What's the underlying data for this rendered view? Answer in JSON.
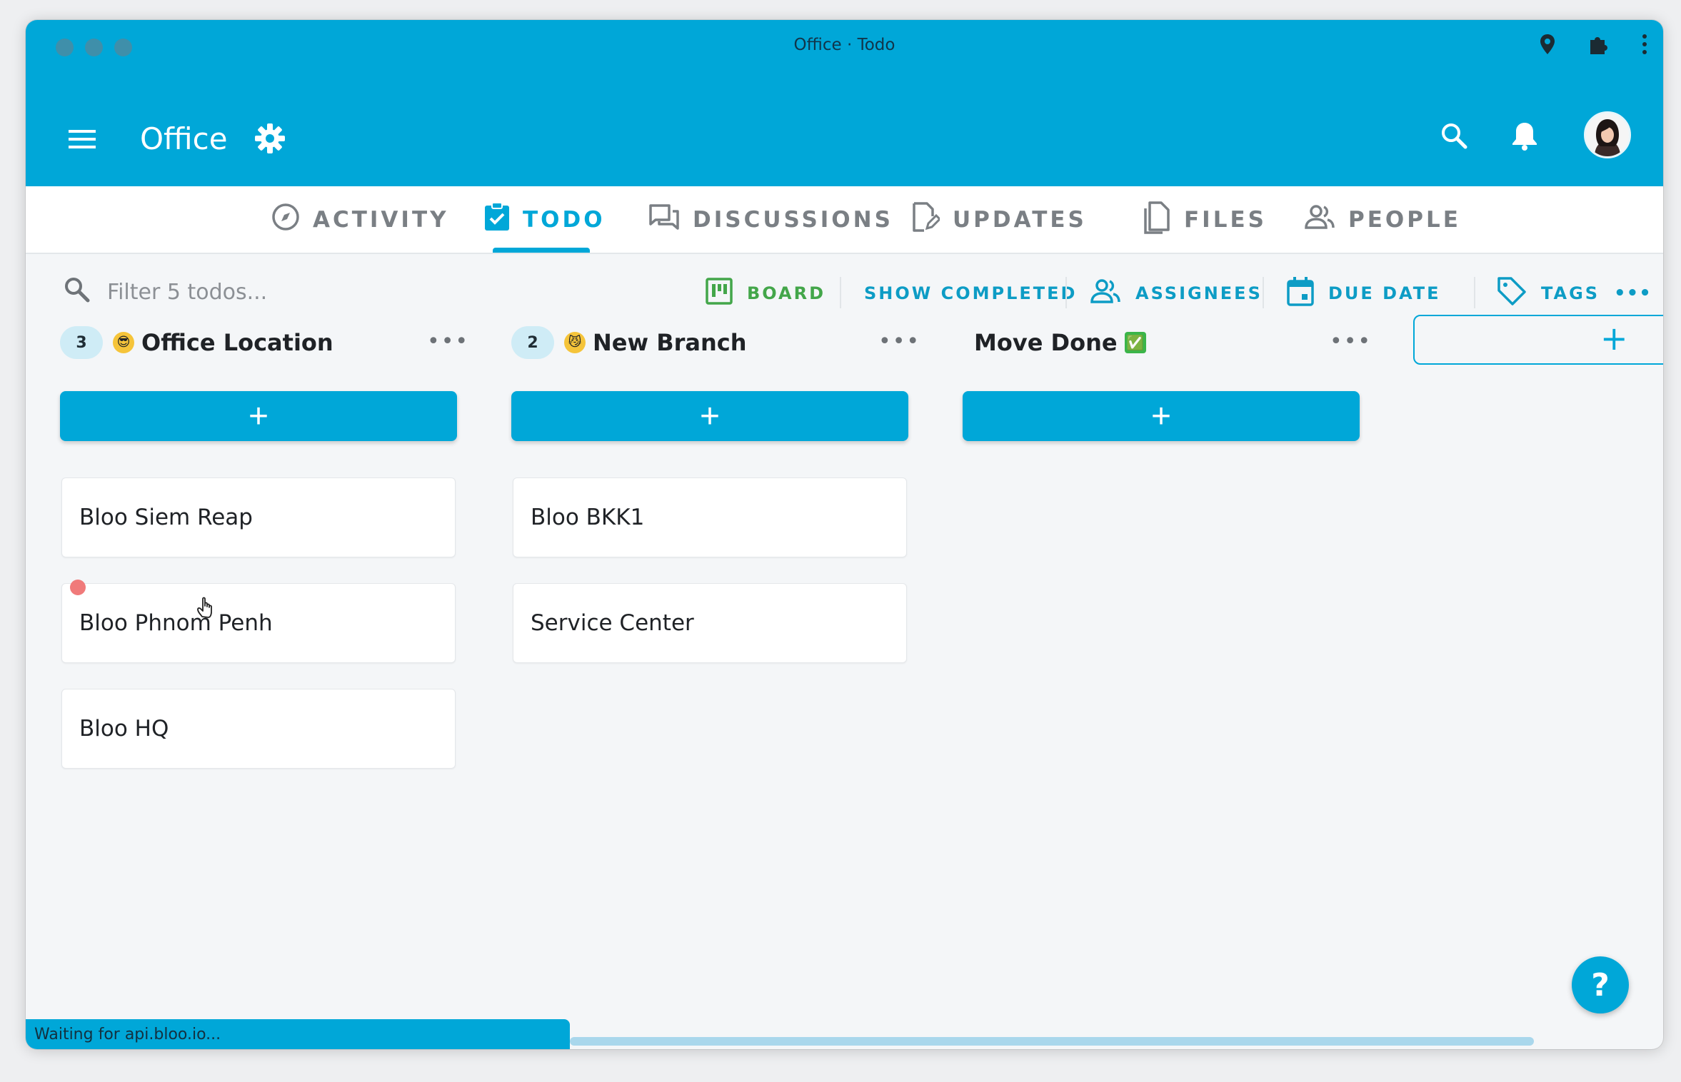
{
  "window": {
    "title": "Office · Todo"
  },
  "appbar": {
    "title": "Office"
  },
  "tabs": [
    {
      "label": "ACTIVITY",
      "icon": "compass-icon"
    },
    {
      "label": "TODO",
      "icon": "checkbox-icon",
      "active": true
    },
    {
      "label": "DISCUSSIONS",
      "icon": "chat-icon"
    },
    {
      "label": "UPDATES",
      "icon": "edit-doc-icon"
    },
    {
      "label": "FILES",
      "icon": "files-icon"
    },
    {
      "label": "PEOPLE",
      "icon": "people-icon"
    }
  ],
  "filter": {
    "placeholder": "Filter 5 todos...",
    "board": "BOARD",
    "show_completed": "SHOW COMPLETED",
    "assignees": "ASSIGNEES",
    "due_date": "DUE DATE",
    "tags": "TAGS",
    "more": "•••"
  },
  "columns": [
    {
      "count": "3",
      "emoji": "😎",
      "title": "Office Location",
      "more": "•••",
      "add": "+",
      "cards": [
        "Bloo Siem Reap",
        "Bloo Phnom Penh",
        "Bloo HQ"
      ]
    },
    {
      "count": "2",
      "emoji": "😼",
      "title": "New Branch",
      "more": "•••",
      "add": "+",
      "cards": [
        "Bloo BKK1",
        "Service Center"
      ]
    },
    {
      "title": "Move Done",
      "suffix_emoji": "✅",
      "more": "•••",
      "add": "+",
      "cards": []
    }
  ],
  "new_column": {
    "label": "+"
  },
  "help": {
    "label": "?"
  },
  "status": {
    "text": "Waiting for api.bloo.io..."
  },
  "colors": {
    "accent": "#00a7d8",
    "board_green": "#43a64a",
    "dot_red": "#f07a7a"
  }
}
